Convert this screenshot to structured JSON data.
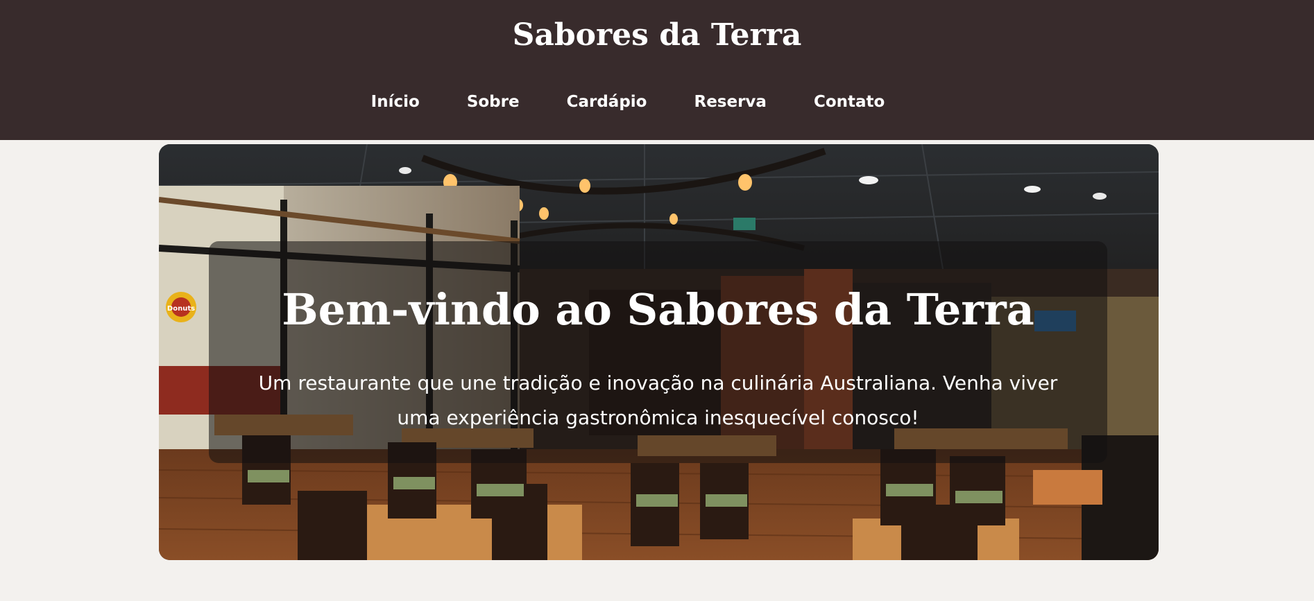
{
  "header": {
    "title": "Sabores da Terra",
    "nav": [
      "Início",
      "Sobre",
      "Cardápio",
      "Reserva",
      "Contato"
    ]
  },
  "hero": {
    "heading": "Bem-vindo ao Sabores da Terra",
    "text": "Um restaurante que une tradição e inovação na culinária Australiana. Venha viver uma experiência gastronômica inesquecível conosco!",
    "image_icon": "restaurant-interior-photo",
    "sign_text": "Donuts"
  },
  "colors": {
    "header_bg": "#382b2c",
    "page_bg": "#f3f1ee",
    "text": "#ffffff"
  }
}
